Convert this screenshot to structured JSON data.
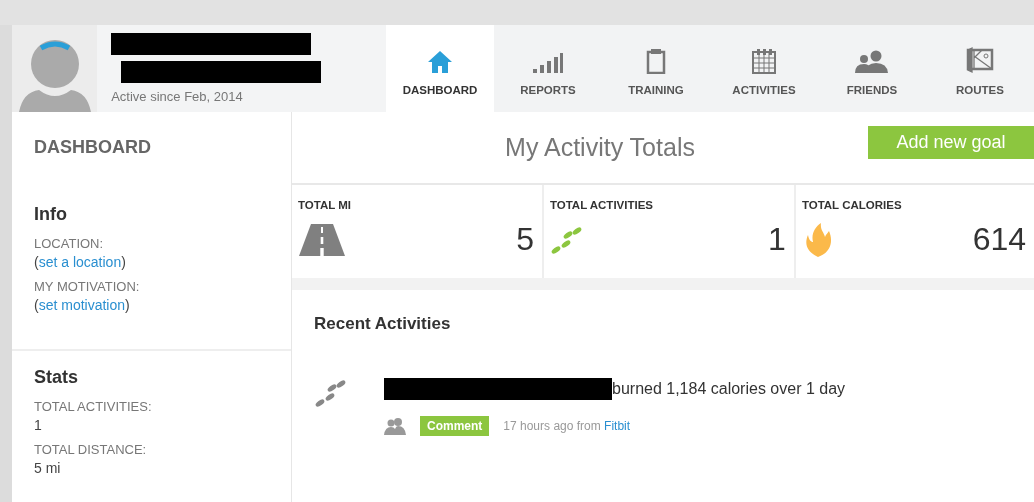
{
  "profile": {
    "name_lines": [
      {
        "kind": "redacted"
      },
      {
        "kind": "redacted"
      }
    ],
    "active_since": "Active since Feb, 2014"
  },
  "tabs": [
    {
      "label": "DASHBOARD",
      "kind": "home",
      "selected": true
    },
    {
      "label": "REPORTS",
      "kind": "bars",
      "selected": false
    },
    {
      "label": "TRAINING",
      "kind": "clipboard",
      "selected": false
    },
    {
      "label": "ACTIVITIES",
      "kind": "calendar",
      "selected": false
    },
    {
      "label": "FRIENDS",
      "kind": "people",
      "selected": false
    },
    {
      "label": "ROUTES",
      "kind": "map",
      "selected": false
    }
  ],
  "sidebar": {
    "title": "DASHBOARD",
    "sections": [
      {
        "title": "Info",
        "fields": [
          {
            "kind": "link",
            "label": "LOCATION:",
            "open": "(",
            "link": "set a location",
            "close": ")"
          },
          {
            "kind": "link",
            "label": "MY MOTIVATION:",
            "open": "(",
            "link": "set motivation",
            "close": ")"
          }
        ]
      },
      {
        "title": "Stats",
        "fields": [
          {
            "kind": "value",
            "label": "TOTAL ACTIVITIES:",
            "value": "1"
          },
          {
            "kind": "value",
            "label": "TOTAL DISTANCE:",
            "value": "5 mi"
          }
        ]
      }
    ]
  },
  "totals": {
    "title": "My Activity Totals",
    "button": "Add new goal",
    "items": [
      {
        "label": "TOTAL MI",
        "kind": "road",
        "value": "5"
      },
      {
        "label": "TOTAL ACTIVITIES",
        "kind": "steps",
        "value": "1"
      },
      {
        "label": "TOTAL CALORIES",
        "kind": "flame",
        "value": "614"
      }
    ]
  },
  "recent": {
    "title": "Recent Activities",
    "items": [
      {
        "kind": "redacted",
        "text": "burned 1,184 calories over 1 day",
        "button": "Comment",
        "time": "17 hours ago from",
        "source": "Fitbit"
      }
    ]
  }
}
